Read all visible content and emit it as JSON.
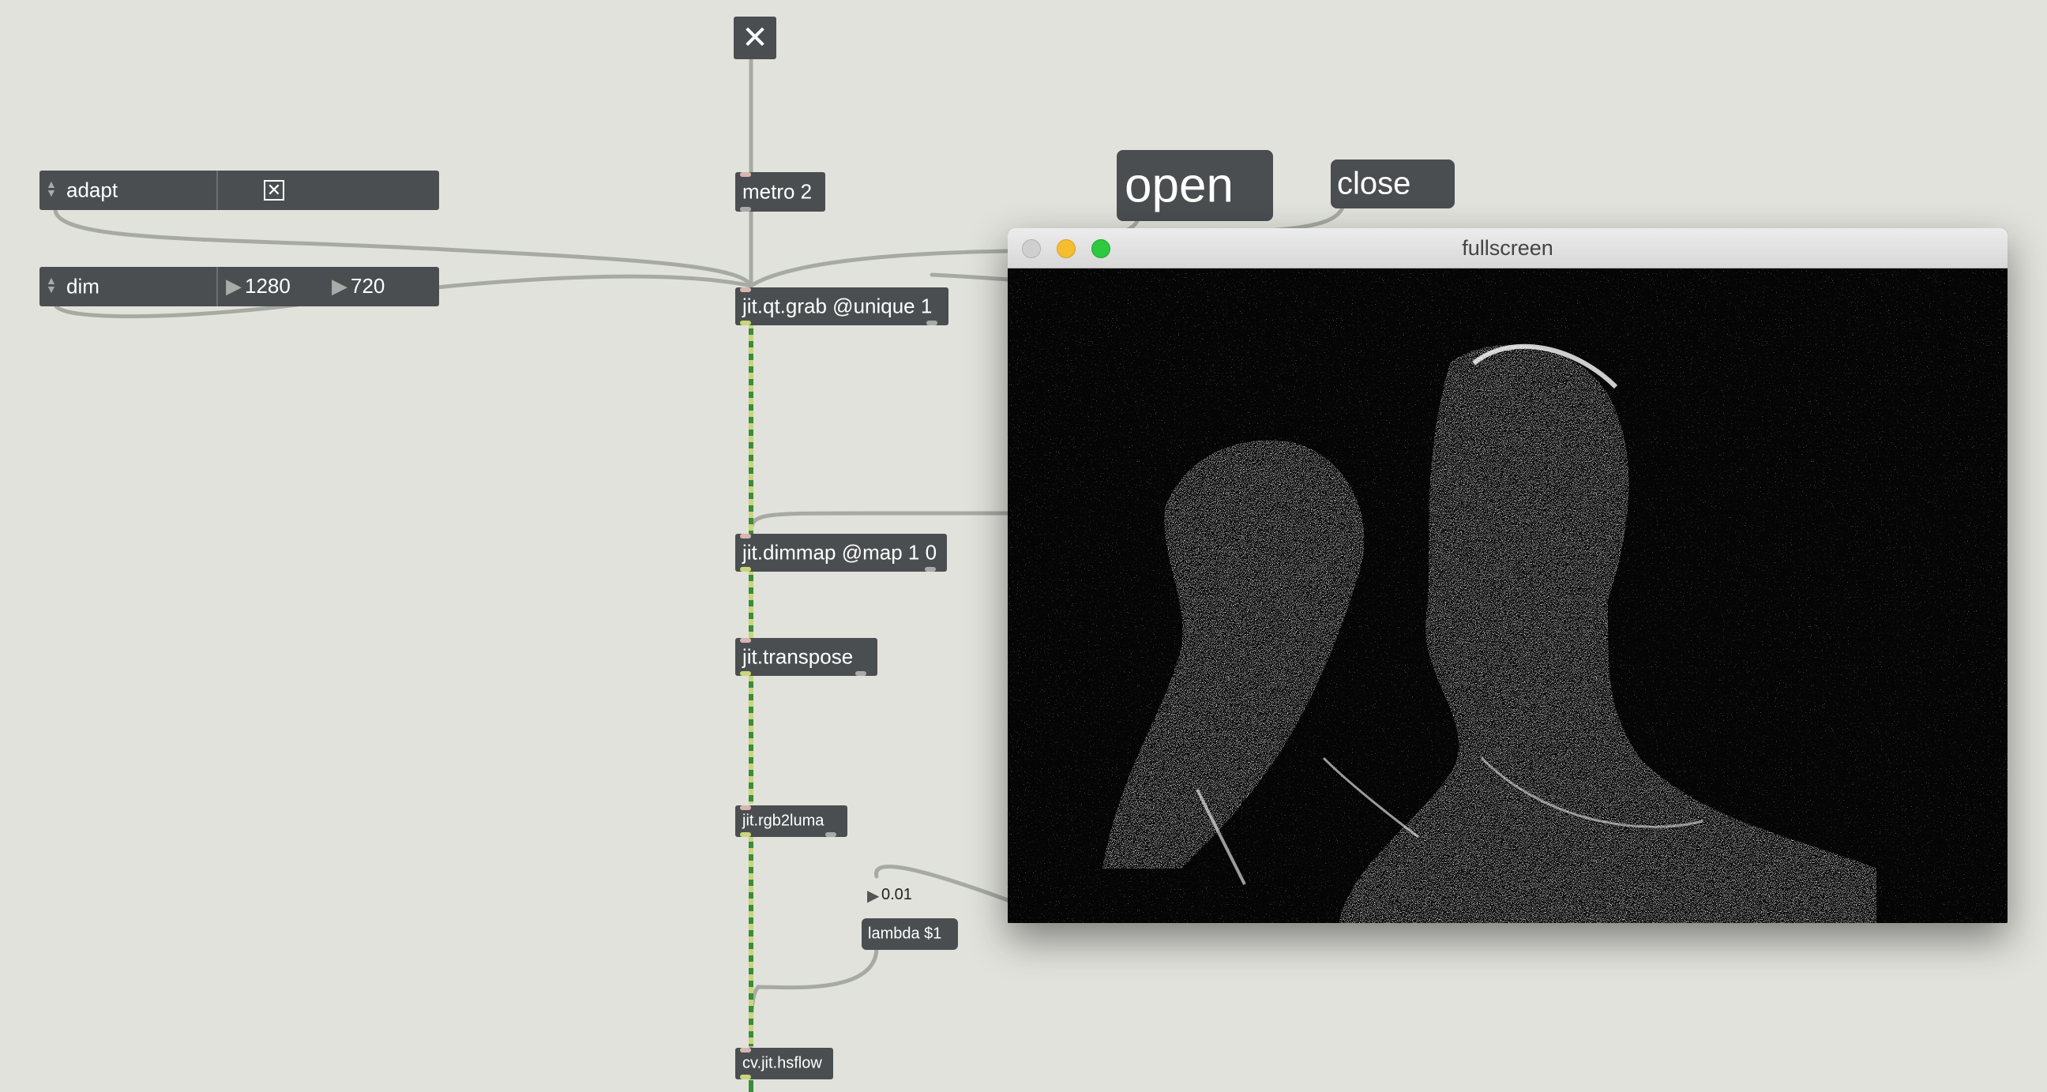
{
  "patcher": {
    "toggle_top_glyph": "✕",
    "objects": {
      "metro": "metro 2",
      "grab": "jit.qt.grab @unique 1",
      "dimmap": "jit.dimmap @map 1 0",
      "transpose": "jit.transpose",
      "rgb2luma": "jit.rgb2luma",
      "lambda": "lambda $1",
      "hsflow": "cv.jit.hsflow"
    },
    "attrui_adapt": {
      "label": "adapt",
      "checkbox_glyph": "✕"
    },
    "attrui_dim": {
      "label": "dim",
      "value_1": "1280",
      "value_2": "720"
    },
    "messages": {
      "open": "open",
      "close": "close"
    },
    "lambda_value": "0.01"
  },
  "window": {
    "title": "fullscreen",
    "traffic_lights": {
      "close_color": "#cfcfcf",
      "minimize_color": "#f5bd2f",
      "zoom_color": "#2ec841"
    }
  },
  "colors": {
    "background": "#e2e2dc",
    "object": "#4a4e50",
    "patchcord": "#a7aaa3",
    "matrix_cord_a": "#3d8b3b",
    "matrix_cord_b": "#c9d67a"
  }
}
